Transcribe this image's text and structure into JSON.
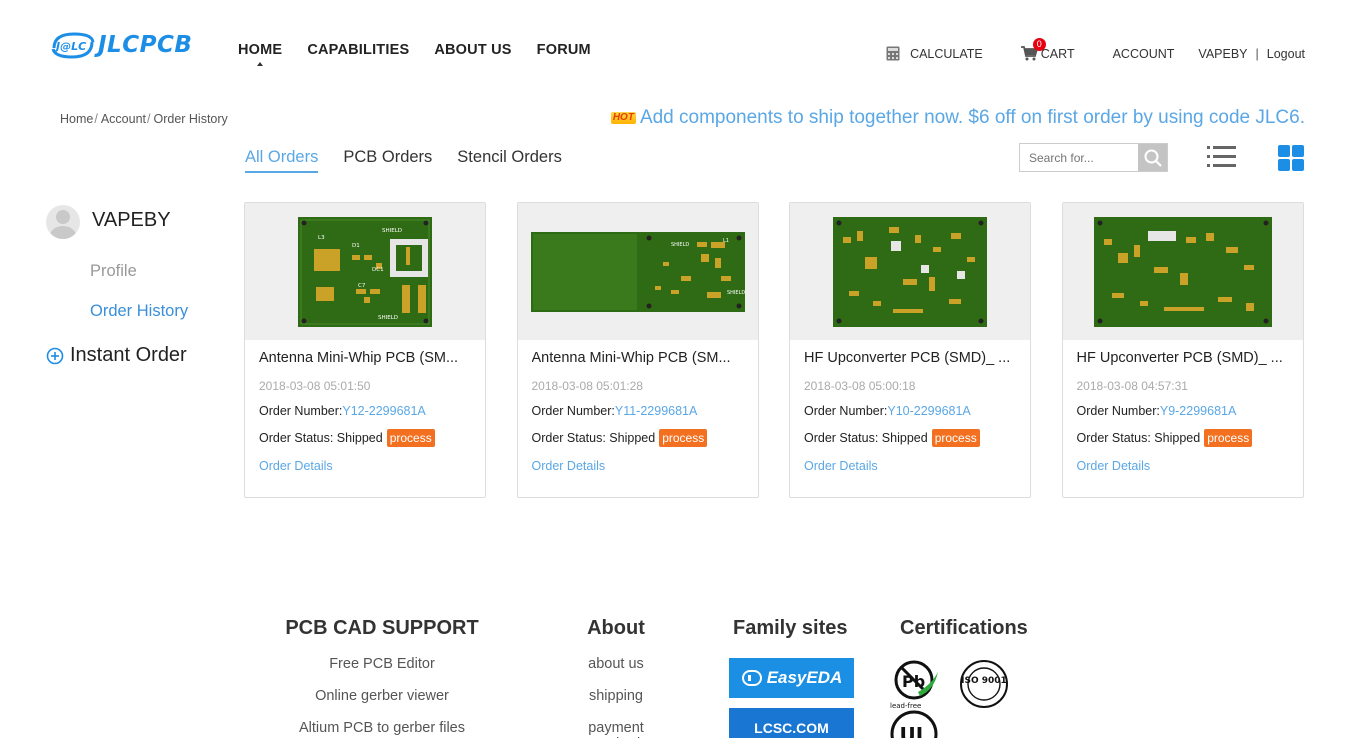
{
  "header": {
    "logo_text": "JLCPCB",
    "logo_badge": "J@LC",
    "nav": [
      "HOME",
      "CAPABILITIES",
      "ABOUT US",
      "FORUM"
    ],
    "calculate": "CALCULATE",
    "cart_label": "CART",
    "cart_count": "0",
    "account": "ACCOUNT",
    "username": "VAPEBY",
    "separator": "|",
    "logout": "Logout"
  },
  "breadcrumb": [
    "Home",
    "Account",
    "Order History"
  ],
  "promo": {
    "hot": "HOT",
    "text": "Add components to ship together now. $6 off on first order by using code JLC6."
  },
  "tabs": [
    "All Orders",
    "PCB Orders",
    "Stencil Orders"
  ],
  "search": {
    "placeholder": "Search for..."
  },
  "sidebar": {
    "username": "VAPEBY",
    "profile": "Profile",
    "order_history": "Order History",
    "instant_order": "Instant Order"
  },
  "orders": [
    {
      "title": "Antenna Mini-Whip PCB (SM...",
      "date": "2018-03-08 05:01:50",
      "number_label": "Order Number:",
      "number": "Y12-2299681A",
      "status_label": "Order Status: Shipped",
      "process": "process",
      "details": "Order Details"
    },
    {
      "title": "Antenna Mini-Whip PCB (SM...",
      "date": "2018-03-08 05:01:28",
      "number_label": "Order Number:",
      "number": "Y11-2299681A",
      "status_label": "Order Status: Shipped",
      "process": "process",
      "details": "Order Details"
    },
    {
      "title": "HF Upconverter PCB (SMD)_ ...",
      "date": "2018-03-08 05:00:18",
      "number_label": "Order Number:",
      "number": "Y10-2299681A",
      "status_label": "Order Status: Shipped",
      "process": "process",
      "details": "Order Details"
    },
    {
      "title": "HF Upconverter PCB (SMD)_ ...",
      "date": "2018-03-08 04:57:31",
      "number_label": "Order Number:",
      "number": "Y9-2299681A",
      "status_label": "Order Status: Shipped",
      "process": "process",
      "details": "Order Details"
    }
  ],
  "footer": {
    "cad_title": "PCB CAD SUPPORT",
    "cad_links": [
      "Free PCB Editor",
      "Online gerber viewer",
      "Altium PCB to gerber files"
    ],
    "about_title": "About",
    "about_links": [
      "about us",
      "shipping",
      "payment method"
    ],
    "family_title": "Family sites",
    "family_sites": [
      "EasyEDA",
      "LCSC.COM"
    ],
    "cert_title": "Certifications",
    "cert_badges": [
      "Pb",
      "lead-free",
      "ISO 9001",
      "UL"
    ]
  },
  "colors": {
    "brand": "#1d8ee6",
    "link": "#5aa7e6",
    "process": "#f37021",
    "pcb_green": "#2f6b14"
  }
}
